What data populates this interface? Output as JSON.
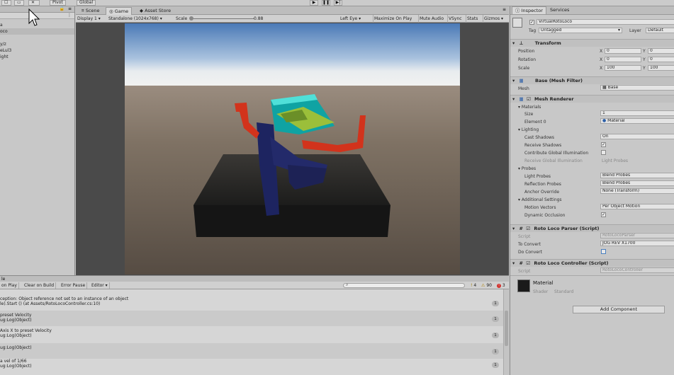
{
  "toolbar": {
    "pivot": "Pivot",
    "global": "Global"
  },
  "hierarchy": {
    "items": [
      "a",
      "oco",
      "",
      "y/z",
      "eLul3",
      "ight"
    ]
  },
  "tabs": {
    "scene": "Scene",
    "game": "Game",
    "asset_store": "Asset Store"
  },
  "game_toolbar": {
    "display": "Display 1",
    "resolution": "Standalone (1024x768)",
    "scale_label": "Scale",
    "scale_value": "0.88",
    "eye": "Left Eye",
    "maximize": "Maximize On Play",
    "mute": "Mute Audio",
    "vsync": "VSync",
    "stats": "Stats",
    "gizmos": "Gizmos"
  },
  "console": {
    "header": "le",
    "buttons": [
      "on Play",
      "Clear on Build",
      "Error Pause",
      "Editor"
    ],
    "counts": {
      "warnings": "4",
      "messages": "90",
      "errors": "3"
    },
    "messages": [
      {
        "line1": "ception: Object reference not set to an instance of an object",
        "line2": "le).Start () (at Assets/RotoLocoController.cs:10)",
        "count": "1"
      },
      {
        "line1": "preset Velocity",
        "line2": "ug:Log(Object)",
        "count": "1"
      },
      {
        "line1": "Axis X to preset Velocity",
        "line2": "ug:Log(Object)",
        "count": "1"
      },
      {
        "line1": "",
        "line2": "ug:Log(Object)",
        "count": "1"
      },
      {
        "line1": "a vel of 1/66",
        "line2": "ug:Log(Object)",
        "count": "1"
      }
    ]
  },
  "inspector": {
    "tab_inspector": "Inspector",
    "tab_services": "Services",
    "object_name": "VirtualRotoLoco",
    "tag_label": "Tag",
    "tag_value": "Untagged",
    "layer_label": "Layer",
    "layer_value": "Default",
    "transform": {
      "title": "Transform",
      "rows": [
        {
          "label": "Position",
          "x": "0",
          "y": "0"
        },
        {
          "label": "Rotation",
          "x": "0",
          "y": "0"
        },
        {
          "label": "Scale",
          "x": "100",
          "y": "100"
        }
      ]
    },
    "mesh_filter": {
      "title": "Base (Mesh Filter)",
      "mesh_label": "Mesh",
      "mesh_value": "Base"
    },
    "mesh_renderer": {
      "title": "Mesh Renderer",
      "materials": "Materials",
      "size_label": "Size",
      "size_value": "1",
      "element0_label": "Element 0",
      "element0_value": "Material",
      "lighting": "Lighting",
      "cast_shadows_label": "Cast Shadows",
      "cast_shadows_value": "On",
      "receive_shadows_label": "Receive Shadows",
      "contribute_gi_label": "Contribute Global Illumination",
      "receive_gi_label": "Receive Global Illumination",
      "receive_gi_value": "Light Probes",
      "probes": "Probes",
      "light_probes_label": "Light Probes",
      "light_probes_value": "Blend Probes",
      "reflection_probes_label": "Reflection Probes",
      "reflection_probes_value": "Blend Probes",
      "anchor_override_label": "Anchor Override",
      "anchor_override_value": "None (Transform)",
      "additional": "Additional Settings",
      "motion_vectors_label": "Motion Vectors",
      "motion_vectors_value": "Per Object Motion",
      "dynamic_occlusion_label": "Dynamic Occlusion"
    },
    "parser": {
      "title": "Roto Loco Parser (Script)",
      "script_label": "Script",
      "script_value": "RotoLocoParser",
      "to_convert_label": "To Convert",
      "to_convert_value": "JOG REV X1700",
      "do_convert_label": "Do Convert"
    },
    "controller": {
      "title": "Roto Loco Controller (Script)",
      "script_label": "Script",
      "script_value": "RotoLocoController"
    },
    "material": {
      "name": "Material",
      "shader_label": "Shader",
      "shader_value": "Standard"
    },
    "add_component": "Add Component"
  }
}
